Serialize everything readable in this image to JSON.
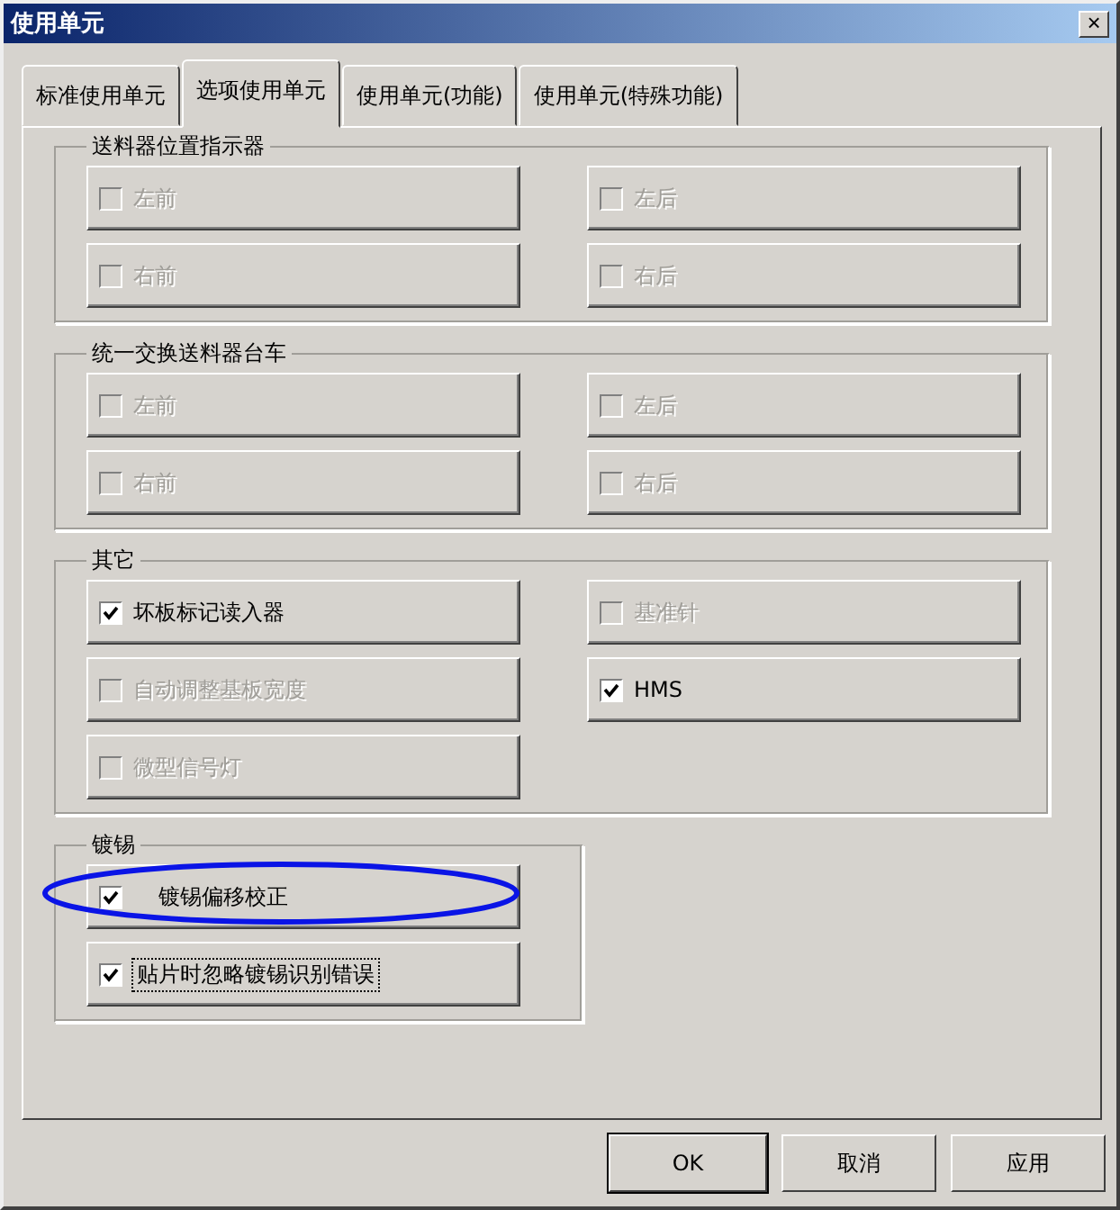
{
  "window": {
    "title": "使用单元",
    "close": "×"
  },
  "tabs": [
    {
      "label": "标准使用单元",
      "selected": false
    },
    {
      "label": "选项使用单元",
      "selected": true
    },
    {
      "label": "使用单元(功能)",
      "selected": false
    },
    {
      "label": "使用单元(特殊功能)",
      "selected": false
    }
  ],
  "groups": [
    {
      "title": "送料器位置指示器",
      "items": [
        {
          "label": "左前",
          "checked": false,
          "disabled": true
        },
        {
          "label": "左后",
          "checked": false,
          "disabled": true
        },
        {
          "label": "右前",
          "checked": false,
          "disabled": true
        },
        {
          "label": "右后",
          "checked": false,
          "disabled": true
        }
      ]
    },
    {
      "title": "统一交换送料器台车",
      "items": [
        {
          "label": "左前",
          "checked": false,
          "disabled": true
        },
        {
          "label": "左后",
          "checked": false,
          "disabled": true
        },
        {
          "label": "右前",
          "checked": false,
          "disabled": true
        },
        {
          "label": "右后",
          "checked": false,
          "disabled": true
        }
      ]
    },
    {
      "title": "其它",
      "items": [
        {
          "label": "坏板标记读入器",
          "checked": true,
          "disabled": false
        },
        {
          "label": "基准针",
          "checked": false,
          "disabled": true
        },
        {
          "label": "自动调整基板宽度",
          "checked": false,
          "disabled": true
        },
        {
          "label": "HMS",
          "checked": true,
          "disabled": false
        },
        {
          "label": "微型信号灯",
          "checked": false,
          "disabled": true
        }
      ]
    },
    {
      "title": "镀锡",
      "narrow": true,
      "items": [
        {
          "label": "镀锡偏移校正",
          "checked": true,
          "disabled": false,
          "circled": true
        },
        {
          "label": "贴片时忽略镀锡识别错误",
          "checked": true,
          "disabled": false,
          "focused": true
        }
      ]
    }
  ],
  "buttons": [
    {
      "label": "OK",
      "default": true
    },
    {
      "label": "取消",
      "default": false
    },
    {
      "label": "应用",
      "default": false
    }
  ]
}
